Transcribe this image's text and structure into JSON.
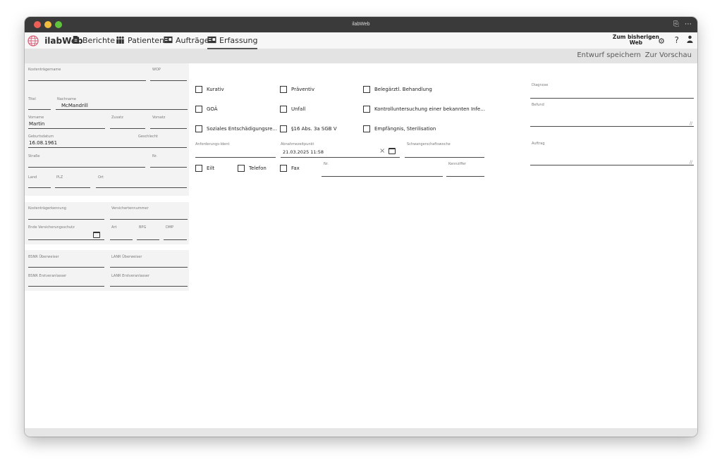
{
  "window": {
    "title": "ilabWeb"
  },
  "nav": {
    "brand": "ilabWeb",
    "items": [
      {
        "label": "Berichte"
      },
      {
        "label": "Patienten"
      },
      {
        "label": "Aufträge"
      },
      {
        "label": "Erfassung"
      }
    ],
    "right_label_line1": "Zum bisherigen",
    "right_label_line2": "Web",
    "help": "?"
  },
  "actions": {
    "save_draft": "Entwurf speichern",
    "preview": "Zur Vorschau"
  },
  "left": {
    "kostentraegername_label": "Kostenträgername",
    "wop_label": "WOP",
    "titel_label": "Titel",
    "nachname_label": "Nachname",
    "nachname_value": "McMandrill",
    "vorname_label": "Vorname",
    "vorname_value": "Martin",
    "zusatz_label": "Zusatz",
    "vorsatz_label": "Vorsatz",
    "geburtsdatum_label": "Geburtsdatum",
    "geburtsdatum_value": "16.08.1961",
    "geschlecht_label": "Geschlecht",
    "strasse_label": "Straße",
    "nr_label": "Nr.",
    "land_label": "Land",
    "plz_label": "PLZ",
    "ort_label": "Ort",
    "kostentraegerkennung_label": "Kostenträgerkennung",
    "versichertennummer_label": "Versichertennummer",
    "ende_versicherungsschutz_label": "Ende Versicherungsschutz",
    "art_label": "Art",
    "bpg_label": "BPG",
    "dmp_label": "DMP",
    "bsnr_ueberweiser_label": "BSNR Überweiser",
    "lanr_ueberweiser_label": "LANR Überweiser",
    "bsnr_erstveranlasser_label": "BSNR Erstveranlasser",
    "lanr_erstveranlasser_label": "LANR Erstveranlasser"
  },
  "middle": {
    "checkboxes": {
      "kurativ": "Kurativ",
      "praeventiv": "Präventiv",
      "belegaerztl": "Belegärztl. Behandlung",
      "goae": "GOÄ",
      "unfall": "Unfall",
      "kontrolluntersuchung": "Kontrolluntersuchung einer bekannten Infe...",
      "soziales": "Soziales Entschädigungsre...",
      "paragraph16": "§16 Abs. 3a SGB V",
      "empfaengnis": "Empfängnis, Sterilisation",
      "eilt": "Eilt",
      "telefon": "Telefon",
      "fax": "Fax"
    },
    "anforderungs_ident_label": "Anforderungs-Ident",
    "abnahmezeitpunkt_label": "Abnahmezeitpunkt",
    "abnahmezeitpunkt_value": "21.03.2025 11:58",
    "schwangerschaftswoche_label": "Schwangerschaftswoche",
    "nr_label": "Nr.",
    "kennziffer_label": "Kennziffer"
  },
  "right": {
    "diagnose_label": "Diagnose",
    "befund_label": "Befund",
    "auftrag_label": "Auftrag"
  }
}
